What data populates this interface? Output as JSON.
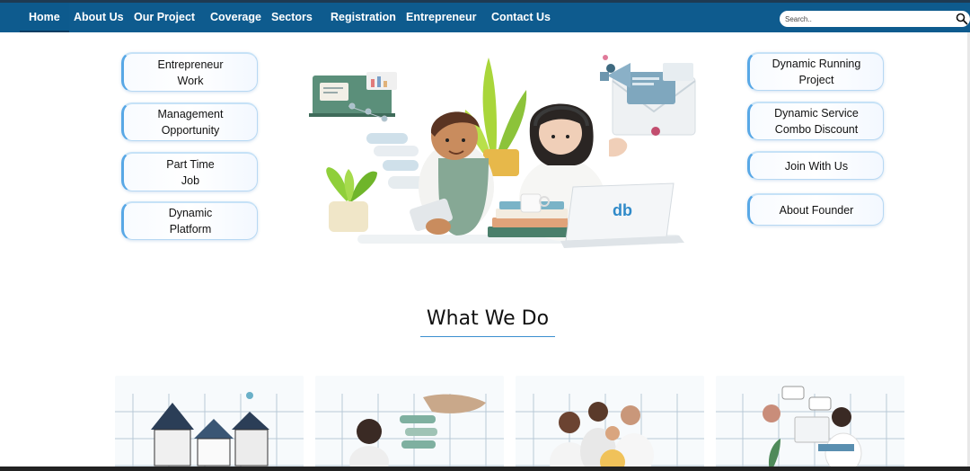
{
  "nav": {
    "items": [
      {
        "label": "Home"
      },
      {
        "label": "About Us"
      },
      {
        "label": "Our Project"
      },
      {
        "label": "Coverage"
      },
      {
        "label": "Sectors"
      },
      {
        "label": "Registration"
      },
      {
        "label": "Entrepreneur"
      },
      {
        "label": "Contact Us"
      }
    ],
    "search_placeholder": "Search.."
  },
  "left_buttons": [
    {
      "line1": "Entrepreneur",
      "line2": "Work"
    },
    {
      "line1": "Management",
      "line2": "Opportunity"
    },
    {
      "line1": "Part Time",
      "line2": "Job"
    },
    {
      "line1": "Dynamic",
      "line2": "Platform"
    }
  ],
  "right_buttons": [
    {
      "line1": "Dynamic Running",
      "line2": "Project"
    },
    {
      "line1": "Dynamic Service",
      "line2": "Combo Discount"
    },
    {
      "line1": "Join With Us",
      "line2": ""
    },
    {
      "line1": "About Founder",
      "line2": ""
    }
  ],
  "hero": {
    "laptop_logo": "db"
  },
  "what_we_do": {
    "title": "What We Do"
  },
  "colors": {
    "nav_bg": "#0e5b8e",
    "accent": "#3b8fd0"
  }
}
